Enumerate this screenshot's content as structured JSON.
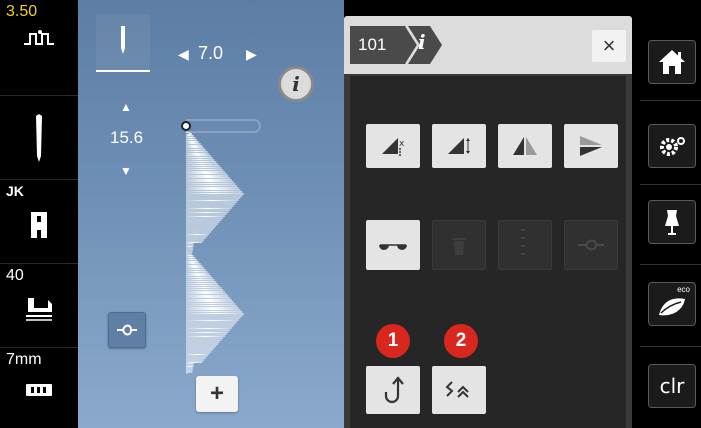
{
  "status": {
    "stitch_width": "3.50",
    "thread_label": "JK",
    "presser_value": "40",
    "seam_allowance": "7mm"
  },
  "editor": {
    "stitch_length": "7.0",
    "stitch_density": "15.6",
    "info_label": "i",
    "add_label": "+"
  },
  "panel": {
    "stitch_number": "101",
    "info_tab": "i",
    "close_label": "×",
    "callouts": [
      "1",
      "2"
    ]
  },
  "nav": {
    "clr_label": "clr",
    "eco_label": "eco"
  },
  "colors": {
    "callout_red": "#d8281e",
    "status_yellow": "#f2d21b",
    "canvas_blue": "#6f90b6"
  }
}
